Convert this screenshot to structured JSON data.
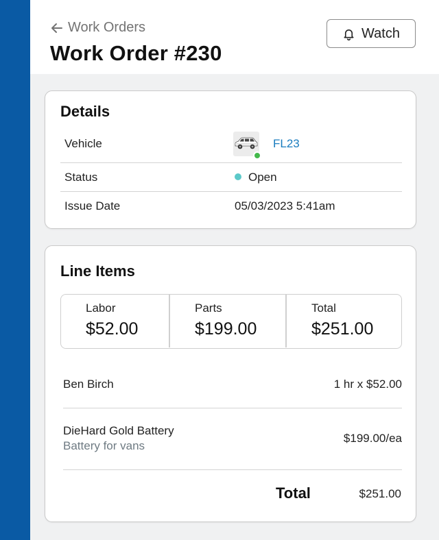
{
  "header": {
    "back_label": "Work Orders",
    "title": "Work Order #230",
    "watch_label": "Watch"
  },
  "details": {
    "title": "Details",
    "rows": {
      "vehicle": {
        "label": "Vehicle",
        "value": "FL23",
        "vehicle_status_color": "#43b84b"
      },
      "status": {
        "label": "Status",
        "value": "Open",
        "dot_color": "#5cc9c9"
      },
      "issue_date": {
        "label": "Issue Date",
        "value": "05/03/2023 5:41am"
      }
    }
  },
  "line_items": {
    "title": "Line Items",
    "summary": {
      "labor": {
        "label": "Labor",
        "value": "$52.00"
      },
      "parts": {
        "label": "Parts",
        "value": "$199.00"
      },
      "total": {
        "label": "Total",
        "value": "$251.00"
      }
    },
    "items": [
      {
        "name": "Ben Birch",
        "description": "",
        "amount": "1 hr x $52.00"
      },
      {
        "name": "DieHard Gold Battery",
        "description": "Battery for vans",
        "amount": "$199.00/ea"
      }
    ],
    "total_label": "Total",
    "total_value": "$251.00"
  },
  "colors": {
    "sidebar": "#0a5aa4",
    "link": "#1a7cbf",
    "background": "#f0f1f2"
  },
  "icons": {
    "back": "arrow-left-icon",
    "watch": "bell-icon",
    "vehicle": "car-icon"
  }
}
